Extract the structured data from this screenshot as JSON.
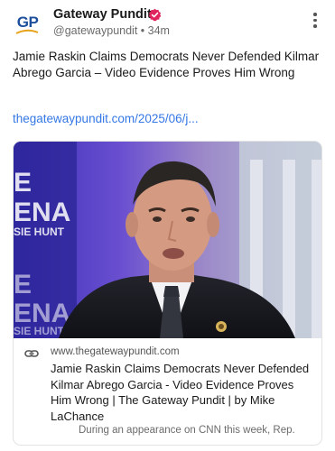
{
  "post": {
    "author": {
      "name": "Gateway Pundit",
      "handle": "@gatewaypundit",
      "time": "34m",
      "avatar_text": "GP",
      "verified_color": "#e0245e"
    },
    "text": "Jamie Raskin Claims Democrats Never Defended Kilmar Abrego Garcia – Video Evidence Proves Him Wrong",
    "link_text": "thegatewaypundit.com/2025/06/j...",
    "card": {
      "domain": "www.thegatewaypundit.com",
      "title": "Jamie Raskin Claims Democrats Never Defended Kilmar Abrego Garcia - Video Evidence Proves Him Wrong | The Gateway Pundit | by Mike LaChance",
      "description": "During an appearance on CNN this week, Rep."
    }
  },
  "icons": {
    "verified": "verified-badge-icon",
    "more": "more-options-icon",
    "link": "link-chain-icon"
  },
  "colors": {
    "link": "#3578e5",
    "brand": "#1d4f9c",
    "verified": "#e0245e"
  }
}
